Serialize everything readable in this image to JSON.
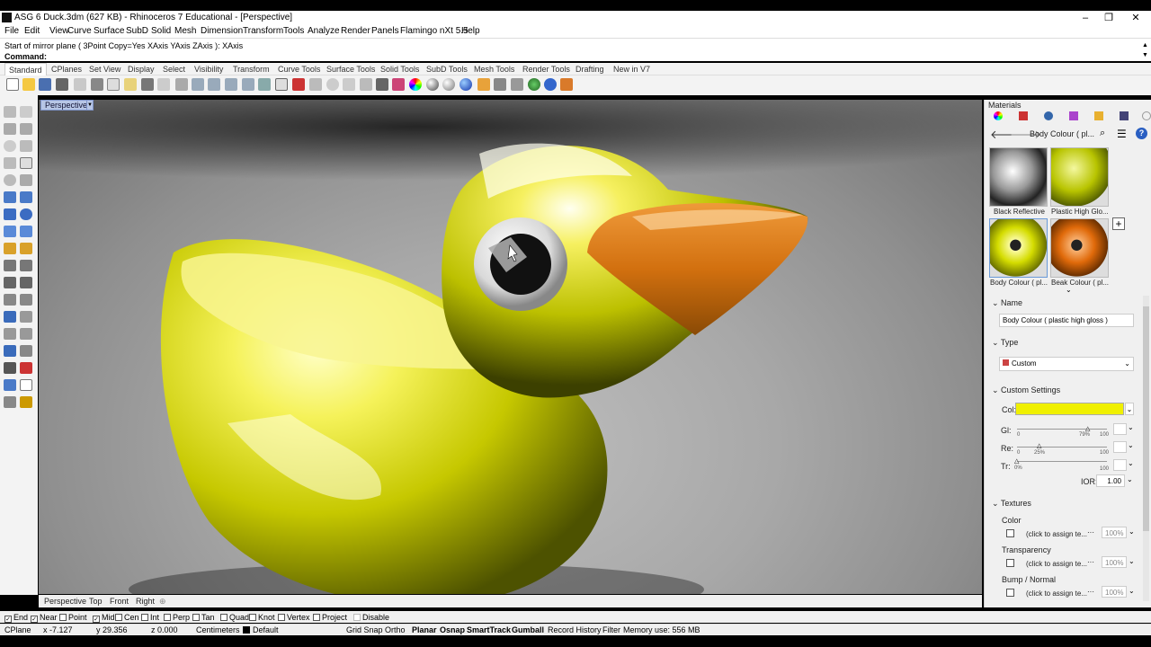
{
  "window": {
    "title": "ASG 6 Duck.3dm (627 KB) - Rhinoceros 7 Educational - [Perspective]",
    "minimize": "–",
    "maximize": "❐",
    "close": "✕"
  },
  "menu": [
    "File",
    "Edit",
    "View",
    "Curve",
    "Surface",
    "SubD",
    "Solid",
    "Mesh",
    "Dimension",
    "Transform",
    "Tools",
    "Analyze",
    "Render",
    "Panels",
    "Flamingo nXt 5.5",
    "Help"
  ],
  "command": {
    "history": "Start of mirror plane ( 3Point  Copy=Yes  XAxis  YAxis  ZAxis ): XAxis",
    "prompt": "Command:"
  },
  "toolbar_tabs": [
    "Standard",
    "CPlanes",
    "Set View",
    "Display",
    "Select",
    "Visibility",
    "Transform",
    "Curve Tools",
    "Surface Tools",
    "Solid Tools",
    "SubD Tools",
    "Mesh Tools",
    "Render Tools",
    "Drafting",
    "New in V7"
  ],
  "viewport": {
    "active_label": "Perspective",
    "tabs": [
      "Perspective",
      "Top",
      "Front",
      "Right"
    ],
    "add_tab": "⊕"
  },
  "materials_panel": {
    "title": "Materials",
    "breadcrumb": "Body Colour ( pl...",
    "thumbnails": [
      {
        "label": "Black Reflective",
        "color": "#cfcfcf"
      },
      {
        "label": "Plastic High Glo...",
        "color": "#b8c400"
      },
      {
        "label": "Body Colour ( pl...",
        "color": "#d4dc00"
      },
      {
        "label": "Beak Colour ( pl...",
        "color": "#e06a0a"
      }
    ],
    "add_icon": "+",
    "name_section": "Name",
    "name_value": "Body Colour ( plastic high gloss )",
    "type_section": "Type",
    "type_value": "Custom",
    "custom_section": "Custom Settings",
    "color_label": "Col:",
    "color_value": "#f0f000",
    "gloss_label": "Gl:",
    "gloss_pct": "79%",
    "gloss_level": 0.79,
    "refl_label": "Re:",
    "refl_pct": "25%",
    "refl_level": 0.25,
    "transp_label": "Tr:",
    "transp_pct": "0%",
    "transp_level": 0.0,
    "slider_min": "0",
    "slider_max": "100",
    "ior_label": "IOR:",
    "ior_value": "1.00",
    "textures_section": "Textures",
    "textures": [
      {
        "label": "Color",
        "slot": "(click to assign te...",
        "amount": "100%"
      },
      {
        "label": "Transparency",
        "slot": "(click to assign te...",
        "amount": "100%"
      },
      {
        "label": "Bump / Normal",
        "slot": "(click to assign te...",
        "amount": "100%"
      }
    ]
  },
  "osnaps": [
    {
      "label": "End",
      "checked": true
    },
    {
      "label": "Near",
      "checked": true
    },
    {
      "label": "Point",
      "checked": false
    },
    {
      "label": "Mid",
      "checked": true
    },
    {
      "label": "Cen",
      "checked": false
    },
    {
      "label": "Int",
      "checked": false
    },
    {
      "label": "Perp",
      "checked": false
    },
    {
      "label": "Tan",
      "checked": false
    },
    {
      "label": "Quad",
      "checked": false
    },
    {
      "label": "Knot",
      "checked": false
    },
    {
      "label": "Vertex",
      "checked": false
    },
    {
      "label": "Project",
      "checked": false
    },
    {
      "label": "Disable",
      "checked": false
    }
  ],
  "status": {
    "cplane": "CPlane",
    "x": "x -7.127",
    "y": "y 29.356",
    "z": "z 0.000",
    "units": "Centimeters",
    "layer": "Default",
    "grid_snap": "Grid Snap",
    "ortho": "Ortho",
    "planar": "Planar",
    "osnap": "Osnap",
    "smarttrack": "SmartTrack",
    "gumball": "Gumball",
    "record_history": "Record History",
    "filter": "Filter",
    "memory": "Memory use: 556 MB"
  }
}
